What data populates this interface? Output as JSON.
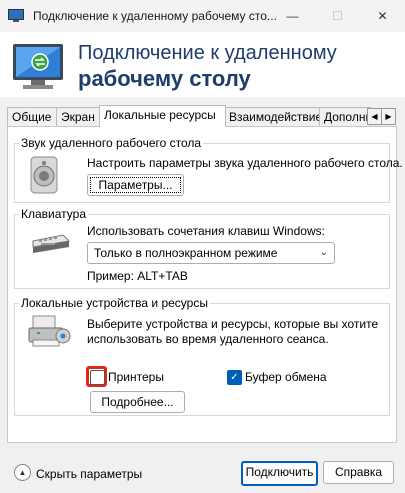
{
  "window": {
    "title": "Подключение к удаленному рабочему сто...",
    "minimize_label": "—",
    "maximize_label": "☐",
    "close_label": "✕"
  },
  "header": {
    "line1": "Подключение к удаленному",
    "line2": "рабочему столу",
    "icon": "remote-desktop-icon"
  },
  "tabs": [
    {
      "label": "Общие"
    },
    {
      "label": "Экран"
    },
    {
      "label": "Локальные ресурсы"
    },
    {
      "label": "Взаимодействие"
    },
    {
      "label": "Дополнит"
    }
  ],
  "tab_scroll": {
    "left": "◀",
    "right": "▶"
  },
  "sound": {
    "legend": "Звук удаленного рабочего стола",
    "description": "Настроить параметры звука удаленного рабочего стола.",
    "button": "Параметры...",
    "icon": "speaker-icon"
  },
  "keyboard": {
    "legend": "Клавиатура",
    "description": "Использовать сочетания клавиш Windows:",
    "selected": "Только в полноэкранном режиме",
    "example": "Пример: ALT+TAB",
    "icon": "keyboard-icon"
  },
  "devices": {
    "legend": "Локальные устройства и ресурсы",
    "description_line1": "Выберите устройства и ресурсы, которые вы хотите",
    "description_line2": "использовать во время удаленного сеанса.",
    "printers_label": "Принтеры",
    "printers_checked": false,
    "clipboard_label": "Буфер обмена",
    "clipboard_checked": true,
    "more_button": "Подробнее...",
    "icon": "devices-icon",
    "highlight_color": "#e1261c"
  },
  "footer": {
    "hide_options": "Скрыть параметры",
    "connect_button": "Подключить",
    "help_button": "Справка",
    "accent_color": "#005fb8"
  }
}
